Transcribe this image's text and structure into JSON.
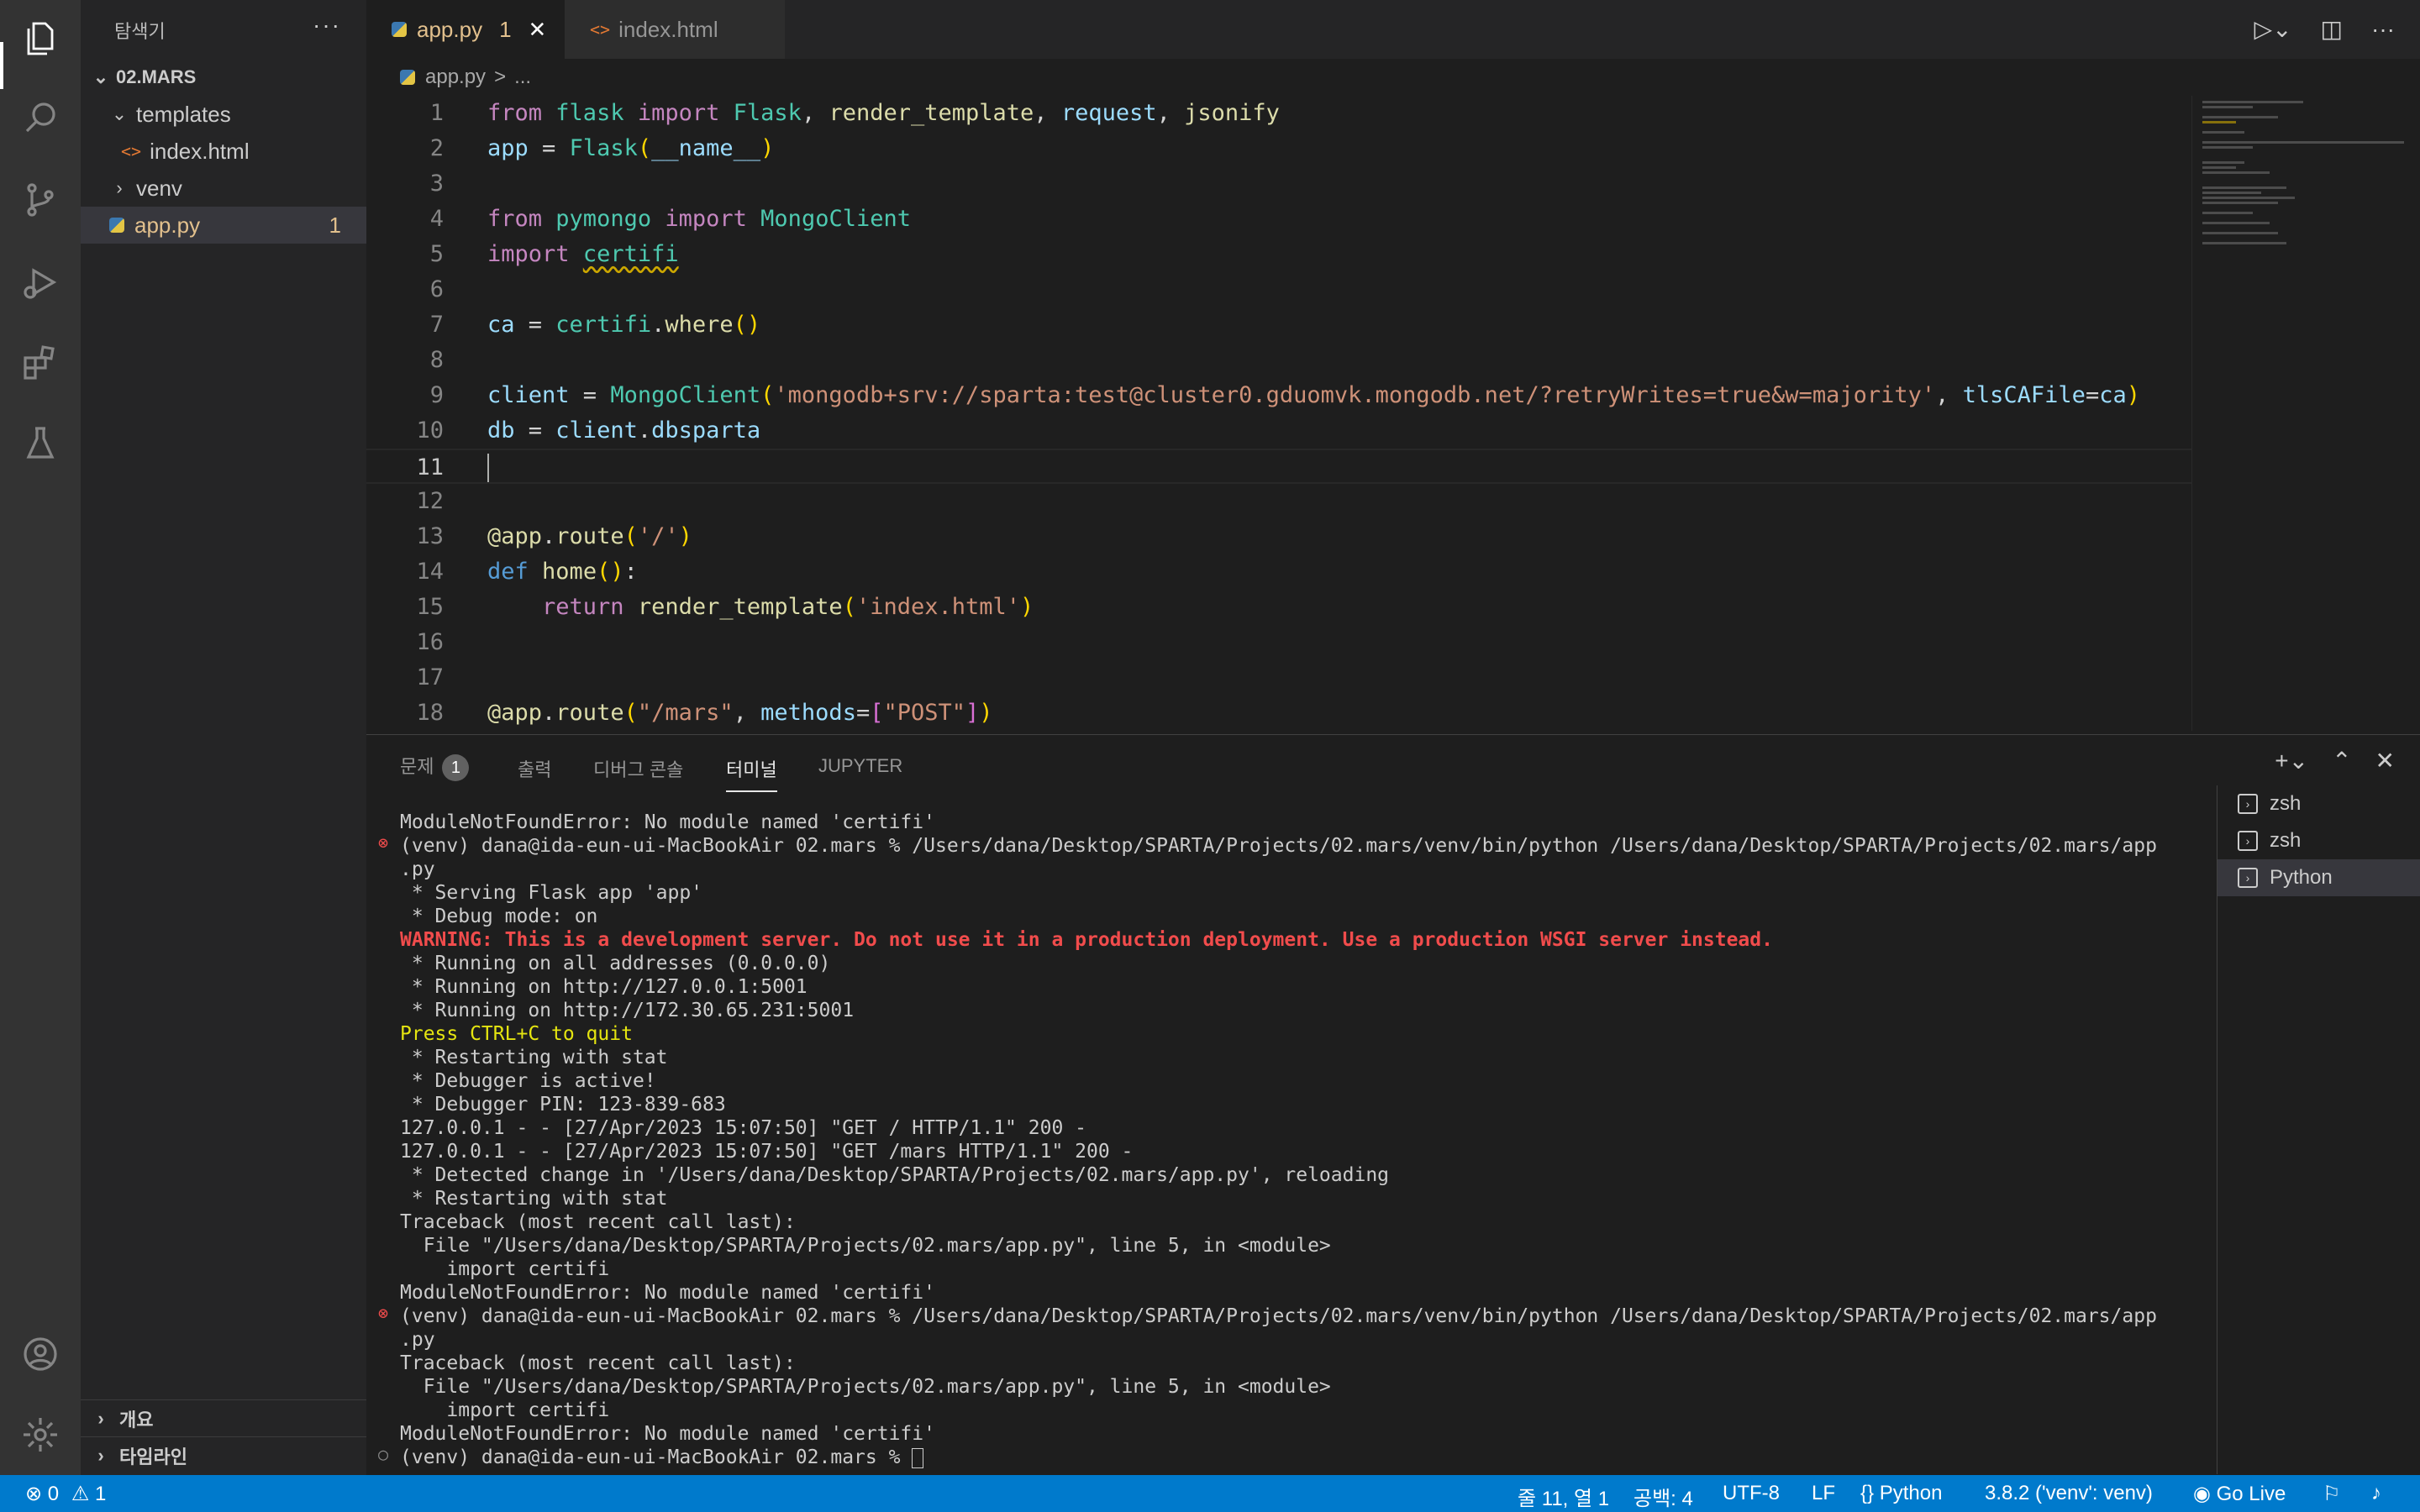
{
  "explorer": {
    "title": "탐색기",
    "more": "···",
    "folder": "02.MARS",
    "items": [
      {
        "label": "templates"
      },
      {
        "label": "index.html"
      },
      {
        "label": "venv"
      },
      {
        "label": "app.py",
        "count": "1"
      }
    ],
    "outline": "개요",
    "timeline": "타임라인"
  },
  "tabs": [
    {
      "label": "app.py",
      "count": "1",
      "close": "✕"
    },
    {
      "label": "index.html"
    }
  ],
  "breadcrumb": {
    "file": "app.py",
    "sep": ">",
    "rest": "..."
  },
  "code": {
    "line_numbers": [
      "1",
      "2",
      "3",
      "4",
      "5",
      "6",
      "7",
      "8",
      "9",
      "10",
      "11",
      "12",
      "13",
      "14",
      "15",
      "16",
      "17",
      "18"
    ],
    "l1": {
      "a": "from",
      "b": "flask",
      "c": "import",
      "d": "Flask",
      "e": "render_template",
      "f": "request",
      "g": "jsonify"
    },
    "l2": {
      "a": "app",
      "b": "Flask",
      "c": "__name__"
    },
    "l4": {
      "a": "from",
      "b": "pymongo",
      "c": "import",
      "d": "MongoClient"
    },
    "l5": {
      "a": "import",
      "b": "certifi"
    },
    "l7": {
      "a": "ca",
      "b": "certifi",
      "c": "where"
    },
    "l9": {
      "a": "client",
      "b": "MongoClient",
      "c": "'mongodb+srv://sparta:test@cluster0.gduomvk.mongodb.net/?retryWrites=true&w=majority'",
      "d": "tlsCAFile",
      "e": "ca"
    },
    "l10": {
      "a": "db",
      "b": "client",
      "c": "dbsparta"
    },
    "l13": {
      "a": "@app",
      "b": "route",
      "c": "'/'"
    },
    "l14": {
      "a": "def",
      "b": "home"
    },
    "l15": {
      "a": "return",
      "b": "render_template",
      "c": "'index.html'"
    },
    "l18": {
      "a": "@app",
      "b": "route",
      "c": "\"/mars\"",
      "d": "methods",
      "e": "\"POST\""
    }
  },
  "panel": {
    "tabs": [
      {
        "label": "문제",
        "badge": "1"
      },
      {
        "label": "출력"
      },
      {
        "label": "디버그 콘솔"
      },
      {
        "label": "터미널"
      },
      {
        "label": "JUPYTER"
      }
    ],
    "terminal_lines": [
      "ModuleNotFoundError: No module named 'certifi'",
      "(venv) dana@ida-eun-ui-MacBookAir 02.mars % /Users/dana/Desktop/SPARTA/Projects/02.mars/venv/bin/python /Users/dana/Desktop/SPARTA/Projects/02.mars/app",
      ".py",
      " * Serving Flask app 'app'",
      " * Debug mode: on",
      "WARNING: This is a development server. Do not use it in a production deployment. Use a production WSGI server instead.",
      " * Running on all addresses (0.0.0.0)",
      " * Running on http://127.0.0.1:5001",
      " * Running on http://172.30.65.231:5001",
      "Press CTRL+C to quit",
      " * Restarting with stat",
      " * Debugger is active!",
      " * Debugger PIN: 123-839-683",
      "127.0.0.1 - - [27/Apr/2023 15:07:50] \"GET / HTTP/1.1\" 200 -",
      "127.0.0.1 - - [27/Apr/2023 15:07:50] \"GET /mars HTTP/1.1\" 200 -",
      " * Detected change in '/Users/dana/Desktop/SPARTA/Projects/02.mars/app.py', reloading",
      " * Restarting with stat",
      "Traceback (most recent call last):",
      "  File \"/Users/dana/Desktop/SPARTA/Projects/02.mars/app.py\", line 5, in <module>",
      "    import certifi",
      "ModuleNotFoundError: No module named 'certifi'",
      "(venv) dana@ida-eun-ui-MacBookAir 02.mars % /Users/dana/Desktop/SPARTA/Projects/02.mars/venv/bin/python /Users/dana/Desktop/SPARTA/Projects/02.mars/app",
      ".py",
      "Traceback (most recent call last):",
      "  File \"/Users/dana/Desktop/SPARTA/Projects/02.mars/app.py\", line 5, in <module>",
      "    import certifi",
      "ModuleNotFoundError: No module named 'certifi'",
      "(venv) dana@ida-eun-ui-MacBookAir 02.mars % "
    ],
    "terminals": [
      "zsh",
      "zsh",
      "Python"
    ]
  },
  "status": {
    "errors": "0",
    "warnings": "1",
    "position": "줄 11, 열 1",
    "spaces": "공백: 4",
    "encoding": "UTF-8",
    "eol": "LF",
    "language": "Python",
    "interpreter": "3.8.2 ('venv': venv)",
    "golive": "Go Live"
  },
  "colors": {
    "accent": "#007acc",
    "error": "#f14c4c",
    "warning": "#cca700"
  }
}
